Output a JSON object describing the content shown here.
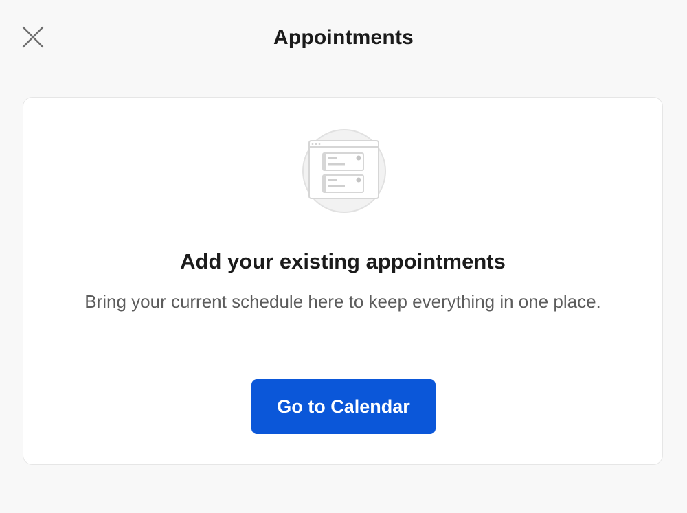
{
  "header": {
    "title": "Appointments",
    "close_icon": "close-icon"
  },
  "empty_state": {
    "illustration_icon": "appointment-list-icon",
    "title": "Add your existing appointments",
    "description": "Bring your current schedule here to keep everything in one place.",
    "button_label": "Go to Calendar"
  },
  "colors": {
    "background": "#f8f8f8",
    "card": "#ffffff",
    "primary": "#0b57d9",
    "text_primary": "#1b1b1b",
    "text_secondary": "#5c5c5c"
  }
}
